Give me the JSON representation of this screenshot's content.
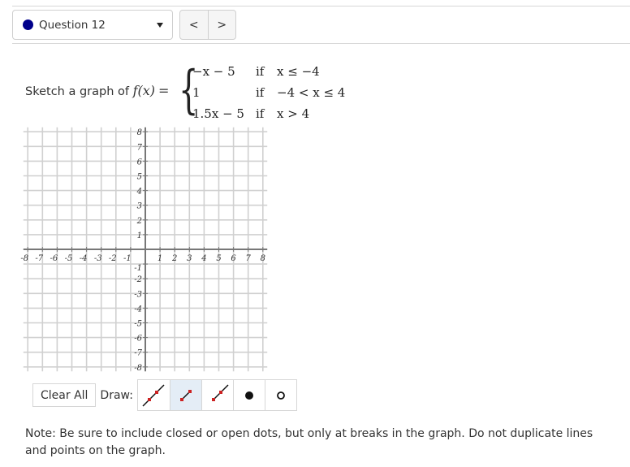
{
  "header": {
    "question_selector": {
      "label": "Question 12",
      "status_color": "#00008b"
    },
    "nav": {
      "prev_label": "<",
      "next_label": ">"
    }
  },
  "prompt": {
    "text": "Sketch a graph of",
    "function_name": "f(x)",
    "equals": "=",
    "cases": [
      {
        "expr": "−x − 5",
        "if": "if",
        "cond": "x ≤ −4"
      },
      {
        "expr": "1",
        "if": "if",
        "cond": "−4 < x ≤ 4"
      },
      {
        "expr": "1.5x − 5",
        "if": "if",
        "cond": "x > 4"
      }
    ]
  },
  "graph": {
    "x_range": [
      -8,
      8
    ],
    "y_range": [
      -8,
      8
    ],
    "x_ticks": [
      "-8",
      "-7",
      "-6",
      "-5",
      "-4",
      "-3",
      "-2",
      "-1",
      "1",
      "2",
      "3",
      "4",
      "5",
      "6",
      "7",
      "8"
    ],
    "y_ticks": [
      "8",
      "7",
      "6",
      "5",
      "4",
      "3",
      "2",
      "1",
      "-1",
      "-2",
      "-3",
      "-4",
      "-5",
      "-6",
      "-7",
      "-8"
    ],
    "grid_color": "#d0d0d0",
    "axis_color": "#777777"
  },
  "toolbar": {
    "clear_label": "Clear All",
    "draw_label": "Draw:",
    "tools": [
      {
        "name": "line",
        "active": false
      },
      {
        "name": "segment",
        "active": true
      },
      {
        "name": "ray",
        "active": false
      },
      {
        "name": "closed-dot",
        "active": false
      },
      {
        "name": "open-dot",
        "active": false
      }
    ],
    "point_color": "#cc2222",
    "active_bg": "#e4edf6"
  },
  "note": "Note: Be sure to include closed or open dots, but only at breaks in the graph. Do not duplicate lines and points on the graph."
}
